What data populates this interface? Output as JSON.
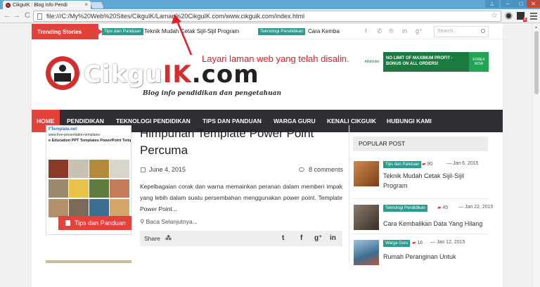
{
  "browser": {
    "tab_title": "CikguIK : Blog Info Pendi",
    "tab_close": "×",
    "url": "file:///C:/My%20Web%20Sites/CikguIK/Laman%20CikguIK.com/www.cikguik.com/index.html",
    "ext_badge": "3",
    "win_user": "⊥",
    "win_min": "–",
    "win_max": "□",
    "win_close": "✕",
    "back": "←",
    "forward": "→",
    "reload": "C",
    "star": "☆"
  },
  "annotation": "Layari laman web yang telah disalin.",
  "trending": {
    "label": "Trending Stories",
    "items": [
      {
        "tag": "Tips dan Panduan",
        "text": "Teknik Mudah Cetak Sijil-Sijil Program"
      },
      {
        "tag": "Teknologi Pendidikan",
        "text": "Cara Kemba"
      }
    ],
    "social": [
      "f",
      "✆",
      "℗",
      "in",
      "g⁺"
    ],
    "search_placeholder": "Search..."
  },
  "logo": {
    "part1": "Cikgu",
    "part2": "IK",
    "part3": ".com",
    "tagline": "Blog info pendidikan dan pengetahuan"
  },
  "ad": {
    "logo": "Alfafinder",
    "text1": "NO LIMIT OF MAXIMUM PROFIT -",
    "text2": "BONUS ON ALL ORDERS!",
    "right1": "FOREX",
    "right2": "NOW"
  },
  "nav": [
    "HOME",
    "PENDIDIKAN",
    "TEKNOLOGI PENDIDIKAN",
    "TIPS DAN PANDUAN",
    "WARGA GURU",
    "KENALI CIKGUIK",
    "HUBUNGI KAMI"
  ],
  "post": {
    "thumb_head": "FTemplate.net",
    "thumb_sub": "www.free-presentation-templates",
    "thumb_title": "e Education PPT Templates PowerPoint Template",
    "category": "Tips dan Panduan",
    "title": "Himpunan Template Power Point Percuma",
    "date": "June 4, 2015",
    "comments": "8 comments",
    "excerpt": "Kepelbagaian corak dan warna memainkan peranan dalam memberi impak yang lebih dalam suatu persembahan menggunakan power point. Template Power Point...",
    "readmore": "Baca Selanjutnya...",
    "share_label": "Share",
    "share_icons": [
      "t",
      "f",
      "g⁺",
      "in"
    ]
  },
  "sidebar": {
    "heading": "POPULAR POST",
    "items": [
      {
        "tag": "Tips dan Panduan",
        "count": "90",
        "date": "Jan 6, 2015",
        "title": "Teknik Mudah Cetak Sijil-Sijil Program",
        "color": "#b5652f"
      },
      {
        "tag": "Teknologi Pendidikan",
        "count": "45",
        "date": "Jan 22, 2015",
        "title": "Cara Kembalikan Data Yang Hilang",
        "color": "#6b5a4e"
      },
      {
        "tag": "Warga Guru",
        "count": "16",
        "date": "Jan 12, 2015",
        "title": "Rumah Peranginan Untuk",
        "color": "#3e6d8f"
      }
    ]
  }
}
